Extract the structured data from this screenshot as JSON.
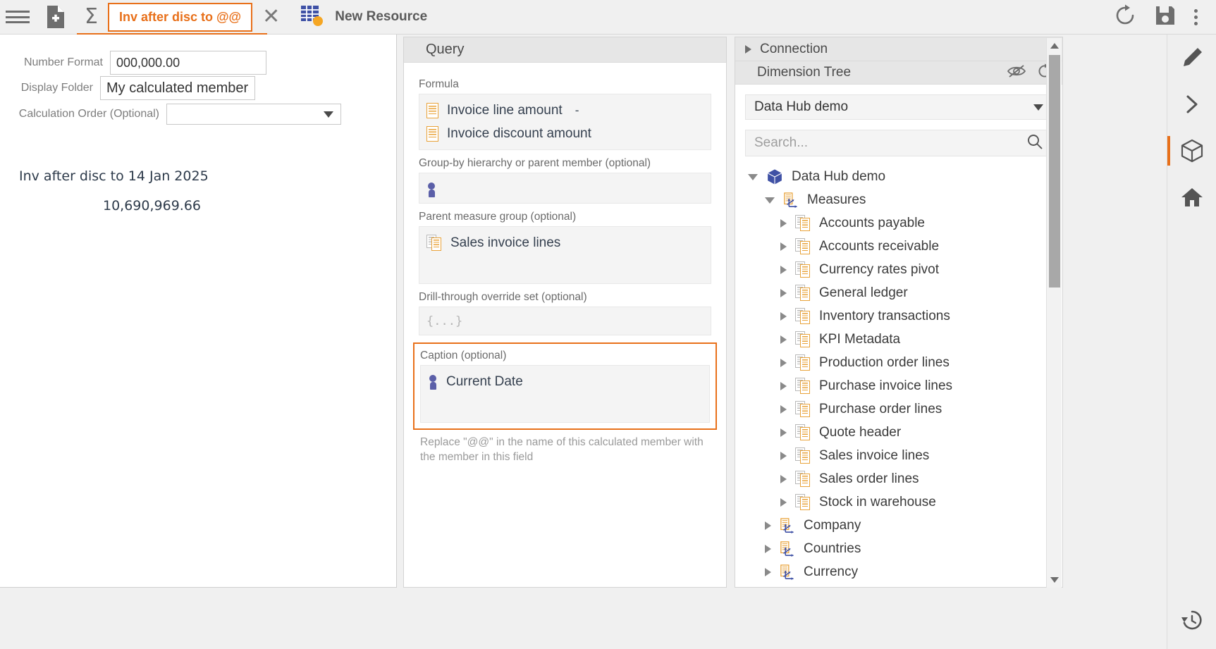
{
  "toolbar": {
    "menu_icon": "hamburger-menu-icon",
    "new_document_icon": "new-document-icon",
    "sigma_icon": "sigma-icon",
    "active_tab_label": "Inv after disc to @@",
    "close_tab_icon": "close-icon",
    "resource_icon": "grid-resource-icon",
    "resource_label": "New Resource",
    "refresh_icon": "refresh-icon",
    "save_icon": "save-icon",
    "more_icon": "kebab-menu-icon"
  },
  "left_panel": {
    "number_format": {
      "label": "Number Format",
      "value": "000,000.00"
    },
    "display_folder": {
      "label": "Display Folder",
      "value": "My calculated members"
    },
    "calculation_order": {
      "label": "Calculation Order (Optional)",
      "value": ""
    },
    "preview_name": "Inv after disc to 14 Jan 2025",
    "preview_value": "10,690,969.66"
  },
  "query": {
    "title": "Query",
    "formula": {
      "label": "Formula",
      "items": [
        {
          "text": "Invoice line amount",
          "operator": "-",
          "icon": "measure-icon"
        },
        {
          "text": "Invoice discount amount",
          "operator": "",
          "icon": "measure-icon"
        }
      ]
    },
    "group_by": {
      "label": "Group-by hierarchy or parent member (optional)",
      "value": "",
      "icon": "member-icon"
    },
    "parent_measure_group": {
      "label": "Parent measure group (optional)",
      "value": "Sales invoice lines",
      "icon": "measure-group-icon"
    },
    "drill_through": {
      "label": "Drill-through override set (optional)",
      "placeholder": "{...}"
    },
    "caption": {
      "label": "Caption (optional)",
      "value": "Current Date",
      "icon": "member-icon",
      "highlight_color": "#e8701a"
    },
    "hint": "Replace \"@@\" in the name of this calculated member with the member in this field"
  },
  "right_panel": {
    "connection": {
      "label": "Connection",
      "expand_icon": "chevron-right-icon"
    },
    "dimension_tree": {
      "label": "Dimension Tree",
      "hide_icon": "eye-off-icon",
      "refresh_icon": "refresh-icon"
    },
    "cube_select": {
      "value": "Data Hub demo",
      "caret_icon": "chevron-down-icon"
    },
    "search": {
      "placeholder": "Search...",
      "value": "",
      "icon": "search-icon"
    },
    "tree": [
      {
        "label": "Data Hub demo",
        "depth": 0,
        "state": "expanded",
        "icon": "cube-icon"
      },
      {
        "label": "Measures",
        "depth": 1,
        "state": "expanded",
        "icon": "axes-icon"
      },
      {
        "label": "Accounts payable",
        "depth": 2,
        "state": "collapsed",
        "icon": "measure-group-icon"
      },
      {
        "label": "Accounts receivable",
        "depth": 2,
        "state": "collapsed",
        "icon": "measure-group-icon"
      },
      {
        "label": "Currency rates pivot",
        "depth": 2,
        "state": "collapsed",
        "icon": "measure-group-icon"
      },
      {
        "label": "General ledger",
        "depth": 2,
        "state": "collapsed",
        "icon": "measure-group-icon"
      },
      {
        "label": "Inventory transactions",
        "depth": 2,
        "state": "collapsed",
        "icon": "measure-group-icon"
      },
      {
        "label": "KPI Metadata",
        "depth": 2,
        "state": "collapsed",
        "icon": "measure-group-icon"
      },
      {
        "label": "Production order lines",
        "depth": 2,
        "state": "collapsed",
        "icon": "measure-group-icon"
      },
      {
        "label": "Purchase invoice lines",
        "depth": 2,
        "state": "collapsed",
        "icon": "measure-group-icon"
      },
      {
        "label": "Purchase order lines",
        "depth": 2,
        "state": "collapsed",
        "icon": "measure-group-icon"
      },
      {
        "label": "Quote header",
        "depth": 2,
        "state": "collapsed",
        "icon": "measure-group-icon"
      },
      {
        "label": "Sales invoice lines",
        "depth": 2,
        "state": "collapsed",
        "icon": "measure-group-icon"
      },
      {
        "label": "Sales order lines",
        "depth": 2,
        "state": "collapsed",
        "icon": "measure-group-icon"
      },
      {
        "label": "Stock in warehouse",
        "depth": 2,
        "state": "collapsed",
        "icon": "measure-group-icon"
      },
      {
        "label": "Company",
        "depth": 1,
        "state": "collapsed",
        "icon": "axes-icon"
      },
      {
        "label": "Countries",
        "depth": 1,
        "state": "collapsed",
        "icon": "axes-icon"
      },
      {
        "label": "Currency",
        "depth": 1,
        "state": "collapsed",
        "icon": "axes-icon"
      }
    ]
  },
  "rail": {
    "edit_icon": "pencil-icon",
    "expand_icon": "chevron-right-icon",
    "cube_icon": "cube-icon",
    "home_icon": "home-icon",
    "history_icon": "history-icon",
    "active_accent": "#e8701a"
  }
}
